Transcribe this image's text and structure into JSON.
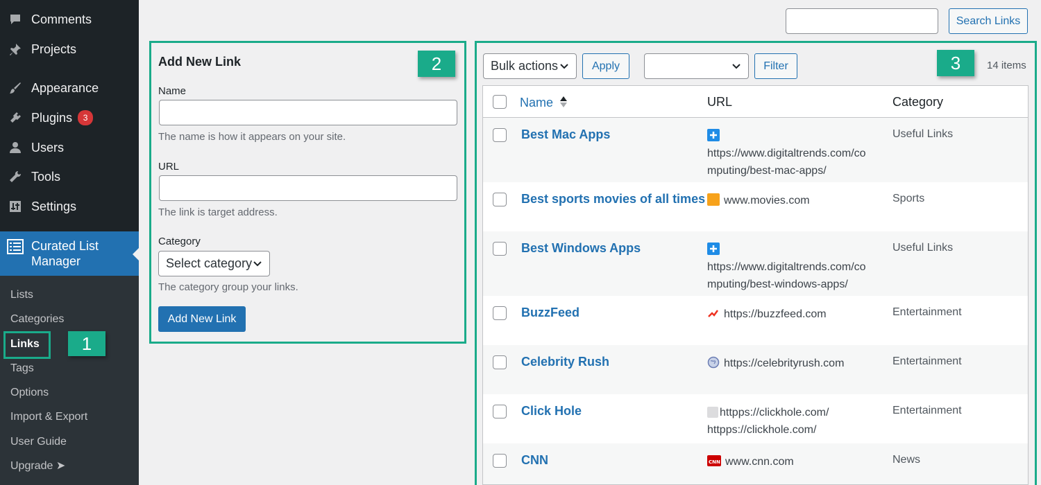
{
  "sidebar": {
    "items": [
      {
        "label": "Comments",
        "icon": "comment-icon"
      },
      {
        "label": "Projects",
        "icon": "pin-icon"
      },
      {
        "label": "Appearance",
        "icon": "brush-icon"
      },
      {
        "label": "Plugins",
        "icon": "plugin-icon",
        "badge": "3"
      },
      {
        "label": "Users",
        "icon": "user-icon"
      },
      {
        "label": "Tools",
        "icon": "wrench-icon"
      },
      {
        "label": "Settings",
        "icon": "settings-icon"
      }
    ],
    "active": {
      "label_line1": "Curated List",
      "label_line2": "Manager",
      "icon": "list-icon"
    },
    "submenu": [
      "Lists",
      "Categories",
      "Links",
      "Tags",
      "Options",
      "Import & Export",
      "User Guide",
      "Upgrade ➤"
    ],
    "current_submenu": "Links"
  },
  "callouts": {
    "one": "1",
    "two": "2",
    "three": "3"
  },
  "search": {
    "value": "",
    "button_label": "Search Links"
  },
  "add_form": {
    "title": "Add New Link",
    "name_label": "Name",
    "name_help": "The name is how it appears on your site.",
    "url_label": "URL",
    "url_help": "The link is target address.",
    "category_label": "Category",
    "category_select": "Select category",
    "category_help": "The category group your links.",
    "submit_label": "Add New Link"
  },
  "toolbar": {
    "bulk_actions": "Bulk actions",
    "apply_label": "Apply",
    "filter_select": "",
    "filter_label": "Filter",
    "items_count": "14 items"
  },
  "table": {
    "columns": [
      "Name",
      "URL",
      "Category"
    ],
    "rows": [
      {
        "name": "Best Mac Apps",
        "url_line1": "https://www.digitaltrends.com/co",
        "url_line2": "mputing/best-mac-apps/",
        "category": "Useful Links",
        "favicon": "digitaltrends-icon"
      },
      {
        "name": "Best sports movies of all times",
        "url_line1": "www.movies.com",
        "url_line2": "",
        "category": "Sports",
        "favicon": "movies-icon"
      },
      {
        "name": "Best Windows Apps",
        "url_line1": "https://www.digitaltrends.com/co",
        "url_line2": "mputing/best-windows-apps/",
        "category": "Useful Links",
        "favicon": "digitaltrends-icon"
      },
      {
        "name": "BuzzFeed",
        "url_line1": "https://buzzfeed.com",
        "url_line2": "",
        "category": "Entertainment",
        "favicon": "buzzfeed-icon"
      },
      {
        "name": "Celebrity Rush",
        "url_line1": "https://celebrityrush.com",
        "url_line2": "",
        "category": "Entertainment",
        "favicon": "globe-icon"
      },
      {
        "name": "Click Hole",
        "url_line1": "httpps://clickhole.com/",
        "url_line2": "httpps://clickhole.com/",
        "category": "Entertainment",
        "favicon": "broken-image-icon"
      },
      {
        "name": "CNN",
        "url_line1": "www.cnn.com",
        "url_line2": "",
        "category": "News",
        "favicon": "cnn-icon"
      }
    ]
  },
  "colors": {
    "accent": "#2271b1",
    "callout": "#1aab8a",
    "sidebar": "#1d2327",
    "badge": "#d63638"
  }
}
